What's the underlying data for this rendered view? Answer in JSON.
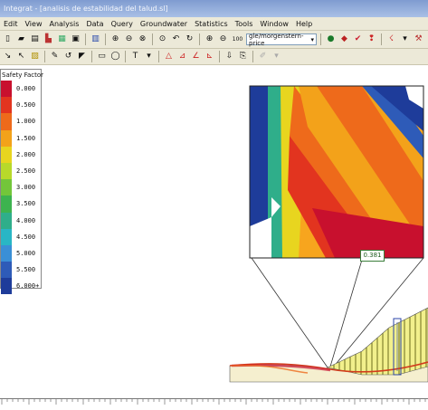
{
  "window": {
    "title": "Integrat - [analisis de estabilidad del talud.sl]"
  },
  "menu": [
    "Edit",
    "View",
    "Analysis",
    "Data",
    "Query",
    "Groundwater",
    "Statistics",
    "Tools",
    "Window",
    "Help"
  ],
  "toolbar": {
    "zoom_label": "100",
    "method_select": "gle/morgenstern-price"
  },
  "legend": {
    "title": "Safety Factor",
    "items": [
      {
        "value": "0.000",
        "color": "#c8102e"
      },
      {
        "value": "0.500",
        "color": "#e2341f"
      },
      {
        "value": "1.000",
        "color": "#ee6a1b"
      },
      {
        "value": "1.500",
        "color": "#f3a21a"
      },
      {
        "value": "2.000",
        "color": "#e8d51f"
      },
      {
        "value": "2.500",
        "color": "#b8d92a"
      },
      {
        "value": "3.000",
        "color": "#73c63a"
      },
      {
        "value": "3.500",
        "color": "#3db34f"
      },
      {
        "value": "4.000",
        "color": "#2fae8a"
      },
      {
        "value": "4.500",
        "color": "#29b6c5"
      },
      {
        "value": "5.000",
        "color": "#3a8fd6"
      },
      {
        "value": "5.500",
        "color": "#2e5bb8"
      },
      {
        "value": "6.000+",
        "color": "#1e3c9a"
      }
    ]
  },
  "callout": {
    "value": "0.381"
  },
  "colors": {
    "ground_fill": "#f2f08c",
    "hatch": "#4a4a00",
    "surface": "#d23b1c",
    "bedrock": "#f5efcf"
  }
}
